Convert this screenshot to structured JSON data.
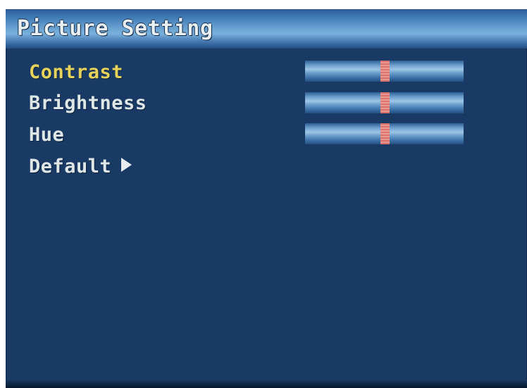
{
  "window": {
    "title": "Picture Setting"
  },
  "menu": [
    {
      "label": "Contrast",
      "selected": true,
      "value": 0.5
    },
    {
      "label": "Brightness",
      "selected": false,
      "value": 0.5
    },
    {
      "label": "Hue",
      "selected": false,
      "value": 0.5
    }
  ],
  "default_item": {
    "label": "Default"
  },
  "icons": {
    "default_arrow": "triangle-right-icon"
  },
  "colors": {
    "background": "#1a3a66",
    "selected_text": "#e8d35a",
    "text": "#dfe6e6",
    "slider_thumb": "#e0706a"
  }
}
